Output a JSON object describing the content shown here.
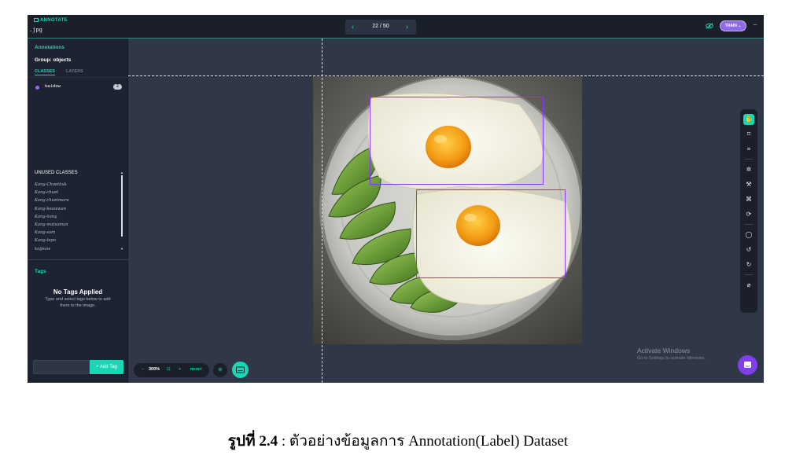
{
  "header": {
    "brand": "ANNOTATE",
    "filename": ".jpg",
    "pager": {
      "prev": "‹",
      "count": "22 / 50",
      "next": "›"
    },
    "train_label": "TRAIN ⌄",
    "more": "···"
  },
  "sidebar": {
    "title": "Annotations",
    "group": "Group: objects",
    "tabs": [
      "CLASSES",
      "LAYERS"
    ],
    "classes": [
      {
        "name": "kaidow",
        "count": "2",
        "color": "#9a63ff"
      }
    ],
    "unused_title": "UNUSED CLASSES",
    "unused": [
      "Kang-Chuetkuk",
      "Kang-chuet",
      "Kang-chuetmara",
      "Kang-keawwan",
      "Kang-liang",
      "Kang-matsaman",
      "Kang-som",
      "Kang-tepo",
      "kaijeaw"
    ],
    "tags_title": "Tags",
    "no_tags": "No Tags Applied",
    "tags_help": "Type and select tags below to add them to the image.",
    "add_tag": "+ Add Tag"
  },
  "canvas": {
    "zoom": {
      "minus": "−",
      "value": "300%",
      "fit": "⊡",
      "plus": "+",
      "reset": "RESET"
    },
    "snap": "✳",
    "tools": [
      "hand-icon",
      "bbox-icon",
      "polygon-icon",
      "smart-select-icon",
      "magic-wand-icon",
      "label-assist-icon",
      "repeat-icon",
      "comment-icon",
      "undo-icon",
      "redo-icon",
      "hide-icon"
    ],
    "watermark_title": "Activate Windows",
    "watermark_sub": "Go to Settings to activate Windows.",
    "bbox_color": "#8e36ff"
  },
  "caption": {
    "label": "รูปที่ 2.4",
    "text": " : ตัวอย่างข้อมูลการ Annotation(Label) Dataset"
  }
}
